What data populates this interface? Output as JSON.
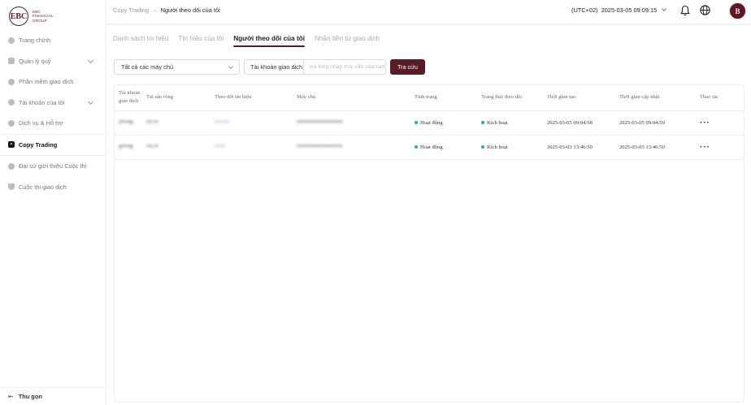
{
  "brand": {
    "logo_letters": "EBC",
    "name_lines": [
      "EBC",
      "FINANCIAL",
      "GROUP"
    ]
  },
  "sidebar": {
    "items": [
      {
        "label": "Trang chính",
        "icon": "home-icon",
        "has_chevron": false
      },
      {
        "label": "Quản lý quỹ",
        "icon": "fund-icon",
        "has_chevron": true
      },
      {
        "label": "Phần mềm giao dịch",
        "icon": "software-icon",
        "has_chevron": false
      },
      {
        "label": "Tài khoản của tôi",
        "icon": "account-icon",
        "has_chevron": true
      },
      {
        "label": "Dịch vụ & Hỗ trợ",
        "icon": "support-icon",
        "has_chevron": false
      },
      {
        "label": "Copy Trading",
        "icon": "copy-trading-icon",
        "active": true
      },
      {
        "label": "Đại sứ giới thiệu Cuộc thi",
        "icon": "ambassador-icon",
        "has_chevron": false
      },
      {
        "label": "Cuộc thi giao dịch",
        "icon": "trophy-icon",
        "has_chevron": false
      }
    ],
    "collapse_label": "Thu gọn"
  },
  "header": {
    "breadcrumb": [
      "Copy Trading",
      "Người theo dõi của tôi"
    ],
    "timezone": "(UTC+02)",
    "datetime": "2025-03-05 09:09:15",
    "avatar_letter": "B"
  },
  "tabs": [
    {
      "label": "Danh sách tín hiệu",
      "active": false
    },
    {
      "label": "Tín hiệu của tôi",
      "active": false
    },
    {
      "label": "Người theo dõi của tôi",
      "active": true
    },
    {
      "label": "Nhận tiền từ giao dịch",
      "active": false
    }
  ],
  "filters": {
    "server_select": "Tất cả các máy chủ",
    "account_select": "Tài khoản giao dịch",
    "search_placeholder": "Vui lòng nhập truy vấn của bạn",
    "search_button": "Tra cứu"
  },
  "table": {
    "columns": [
      "Tài khoản giao dịch",
      "Tài sản ròng",
      "Theo dõi tín hiệu",
      "Máy chủ",
      "Tình trạng",
      "Trạng thái theo dõi",
      "Thời gian tạo",
      "Thời gian cập nhật",
      "Thao tác"
    ],
    "rows": [
      {
        "account": "7****0",
        "equity": "***.**",
        "signal": "*******",
        "server": "**********************",
        "status": "Hoạt động",
        "follow_status": "Kích hoạt",
        "created": "2025-03-05 09:04:58",
        "updated": "2025-03-05 09:04:59",
        "action": "···"
      },
      {
        "account": "2****5",
        "equity": "***.**",
        "signal": "*****",
        "server": "**********************",
        "status": "Hoạt động",
        "follow_status": "Kích hoạt",
        "created": "2025-03-03 13:46:50",
        "updated": "2025-03-03 13:46:50",
        "action": "···"
      }
    ]
  },
  "colors": {
    "brand": "#5a1a26",
    "status_green": "#2bb673",
    "link": "#5b6fc9"
  }
}
